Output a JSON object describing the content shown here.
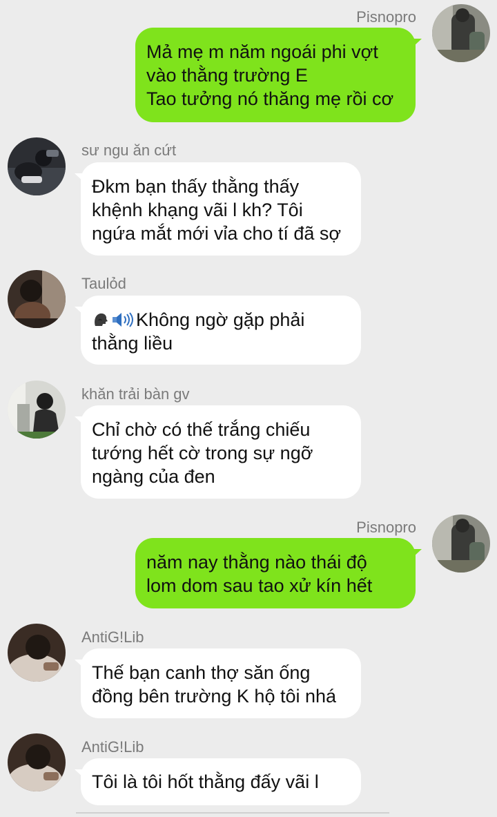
{
  "colors": {
    "background": "#ececec",
    "outgoing_bubble": "#7fe31c",
    "incoming_bubble": "#ffffff",
    "name_text": "#7a7a7a"
  },
  "messages": [
    {
      "sender": "Pisnopro",
      "side": "right",
      "lines": [
        "Mả mẹ m năm ngoái phi vợt",
        "vào thằng trường E",
        "Tao tưởng nó thăng mẹ rồi cơ"
      ]
    },
    {
      "sender": "sư ngu ăn cứt",
      "side": "left",
      "lines": [
        "Đkm bạn thấy thằng thấy",
        "khệnh khạng vãi l kh? Tôi",
        "ngứa mắt mới vỉa cho tí đã sợ"
      ]
    },
    {
      "sender": "Taulỏd",
      "side": "left",
      "icons": [
        "speaking-head-icon",
        "speaker-icon"
      ],
      "lines": [
        "Không ngờ gặp phải",
        "thằng liều"
      ]
    },
    {
      "sender": "khăn trải bàn gv",
      "side": "left",
      "lines": [
        "Chỉ chờ có thế trắng chiếu",
        "tướng hết cờ trong sự ngỡ",
        "ngàng của đen"
      ]
    },
    {
      "sender": "Pisnopro",
      "side": "right",
      "lines": [
        "năm nay thằng nào thái độ",
        "lom dom sau tao xử kín hết"
      ]
    },
    {
      "sender": "AntiG!Lib",
      "side": "left",
      "lines": [
        "Thế bạn canh thợ săn ống",
        "đồng bên trường K hộ tôi nhá"
      ]
    },
    {
      "sender": "AntiG!Lib",
      "side": "left",
      "lines": [
        "Tôi là tôi hốt thằng đấy vãi l"
      ]
    }
  ]
}
